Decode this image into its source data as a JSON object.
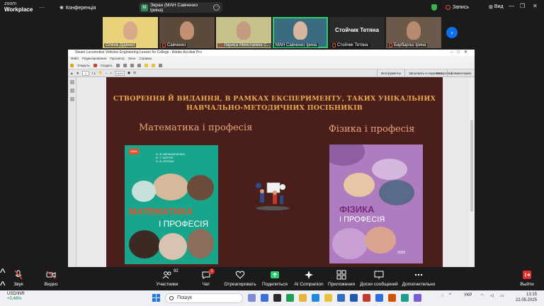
{
  "zoom": {
    "brand_line1": "zoom",
    "brand_line2": "Workplace",
    "conference_label": "Конференція",
    "screen_share_label": "Экран (МАН Савченко Ірина)",
    "screen_badge": "M",
    "record_label": "Запись",
    "view_label": "Вид",
    "next_arrow": "›"
  },
  "participants": [
    {
      "name": "Олена Діденко",
      "muted": false,
      "active": false,
      "skin": "#d9a98a",
      "bg": "#e8d27a"
    },
    {
      "name": "Савченко",
      "muted": true,
      "active": false,
      "skin": "#c28f72",
      "bg": "#5a4a3a"
    },
    {
      "name": "Лариса Миколаївна С...",
      "muted": true,
      "active": false,
      "skin": "#c49a80",
      "bg": "#c7c18a"
    },
    {
      "name": "МАН Савченко Ірина",
      "muted": false,
      "active": true,
      "skin": "#d8b59e",
      "bg": "#3a6b80"
    },
    {
      "name": "Стойчик Тетяна",
      "muted": true,
      "active": false,
      "big": "Стойчик Тетяна"
    },
    {
      "name": "Барбарош Ірина",
      "muted": true,
      "active": false,
      "skin": "#b88a70",
      "bg": "#6a5a4a"
    }
  ],
  "acrobat": {
    "window_title": "Steam Locomotive Vehicles Engineering Lesson for College - Adobe Acrobat Pro",
    "menu": [
      "Файл",
      "Редактирование",
      "Просмотр",
      "Окно",
      "Справка"
    ],
    "open_label": "Открыть",
    "create_label": "Создать",
    "page_number": "1",
    "page_total": "/ 1",
    "zoom_value": "141%",
    "tools_label": "Инструменты",
    "fill_sign_label": "Заполнить и подписать",
    "comments_label": "Комментарии",
    "customize_label": "Настройка"
  },
  "slide": {
    "title_line1": "СТВОРЕННЯ Й ВИДАННЯ, В РАМКАХ ЕКСПЕРИМЕНТУ, ТАКИХ УНІКАЛЬНИХ",
    "title_line2": "НАВЧАЛЬНО-МЕТОДИЧНИХ ПОСІБНИКІВ",
    "left_label": "Математика і професія",
    "right_label": "Фізика і професія",
    "math_book": {
      "authors": [
        "О. В. МЕЛЬНИЧЕНКО",
        "В. Т. ХИТРУК",
        "О. В. КРУПАК"
      ],
      "title": "МАТЕМАТИКА",
      "subtitle": "І ПРОФЕСІЯ",
      "logo": "МАН"
    },
    "phys_book": {
      "title": "ФІЗИКА",
      "subtitle": "І ПРОФЕСІЯ",
      "year": "2020"
    }
  },
  "controls": [
    {
      "label": "Звук",
      "icon": "mic-muted-icon"
    },
    {
      "label": "Видео",
      "icon": "video-off-icon"
    },
    {
      "label": "Участники",
      "icon": "participants-icon",
      "count": "92"
    },
    {
      "label": "Чат",
      "icon": "chat-icon",
      "badge": "1"
    },
    {
      "label": "Отреагировать",
      "icon": "react-icon"
    },
    {
      "label": "Поделиться",
      "icon": "share-icon"
    },
    {
      "label": "AI Companion",
      "icon": "ai-companion-icon"
    },
    {
      "label": "Приложения",
      "icon": "apps-icon"
    },
    {
      "label": "Доски сообщений",
      "icon": "whiteboard-icon"
    },
    {
      "label": "Дополнительно",
      "icon": "more-icon"
    },
    {
      "label": "Выйти",
      "icon": "leave-icon"
    }
  ],
  "taskbar": {
    "ticker_name": "USD/INR",
    "ticker_change": "+0,46%",
    "search_placeholder": "Пошук",
    "lang": "УКР",
    "time": "13:15",
    "date": "22.05.2025"
  }
}
